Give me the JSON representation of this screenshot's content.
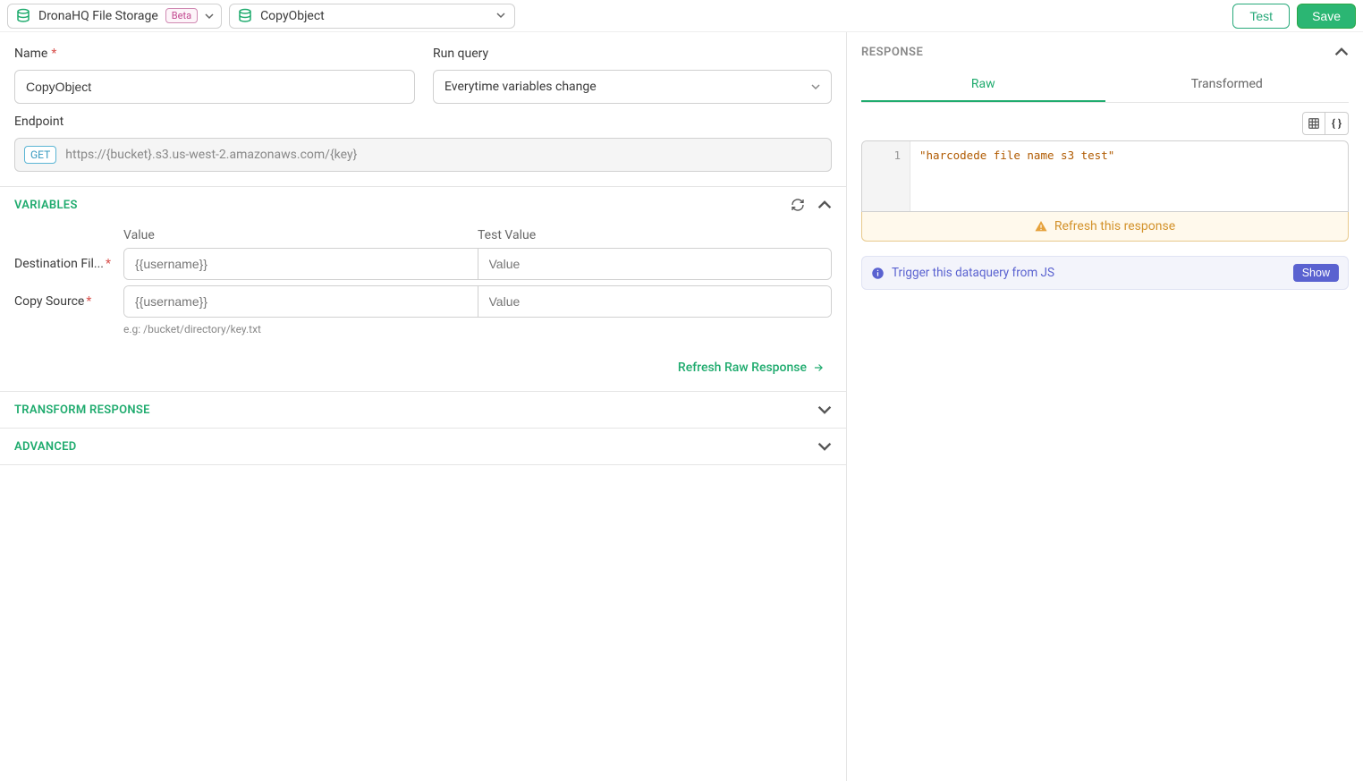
{
  "topbar": {
    "storage_name": "DronaHQ File Storage",
    "beta": "Beta",
    "query_name": "CopyObject"
  },
  "buttons": {
    "test": "Test",
    "save": "Save",
    "show": "Show"
  },
  "form": {
    "name_label": "Name",
    "name_value": "CopyObject",
    "runquery_label": "Run query",
    "runquery_value": "Everytime variables change",
    "endpoint_label": "Endpoint",
    "endpoint_method": "GET",
    "endpoint_url": "https://{bucket}.s3.us-west-2.amazonaws.com/{key}"
  },
  "sections": {
    "variables": "VARIABLES",
    "transform": "TRANSFORM RESPONSE",
    "advanced": "ADVANCED"
  },
  "variables": {
    "header_value": "Value",
    "header_testvalue": "Test Value",
    "rows": [
      {
        "label": "Destination Fil...",
        "required": true,
        "value_placeholder": "{{username}}",
        "test_placeholder": "Value",
        "hint": ""
      },
      {
        "label": "Copy Source",
        "required": true,
        "value_placeholder": "{{username}}",
        "test_placeholder": "Value",
        "hint": "e.g: /bucket/directory/key.txt"
      }
    ],
    "refresh_raw": "Refresh Raw Response"
  },
  "response": {
    "title": "RESPONSE",
    "tabs": {
      "raw": "Raw",
      "transformed": "Transformed"
    },
    "code_line_no": "1",
    "code_text": "\"harcodede file name s3 test\"",
    "refresh_banner": "Refresh this response",
    "js_banner": "Trigger this dataquery from JS"
  }
}
